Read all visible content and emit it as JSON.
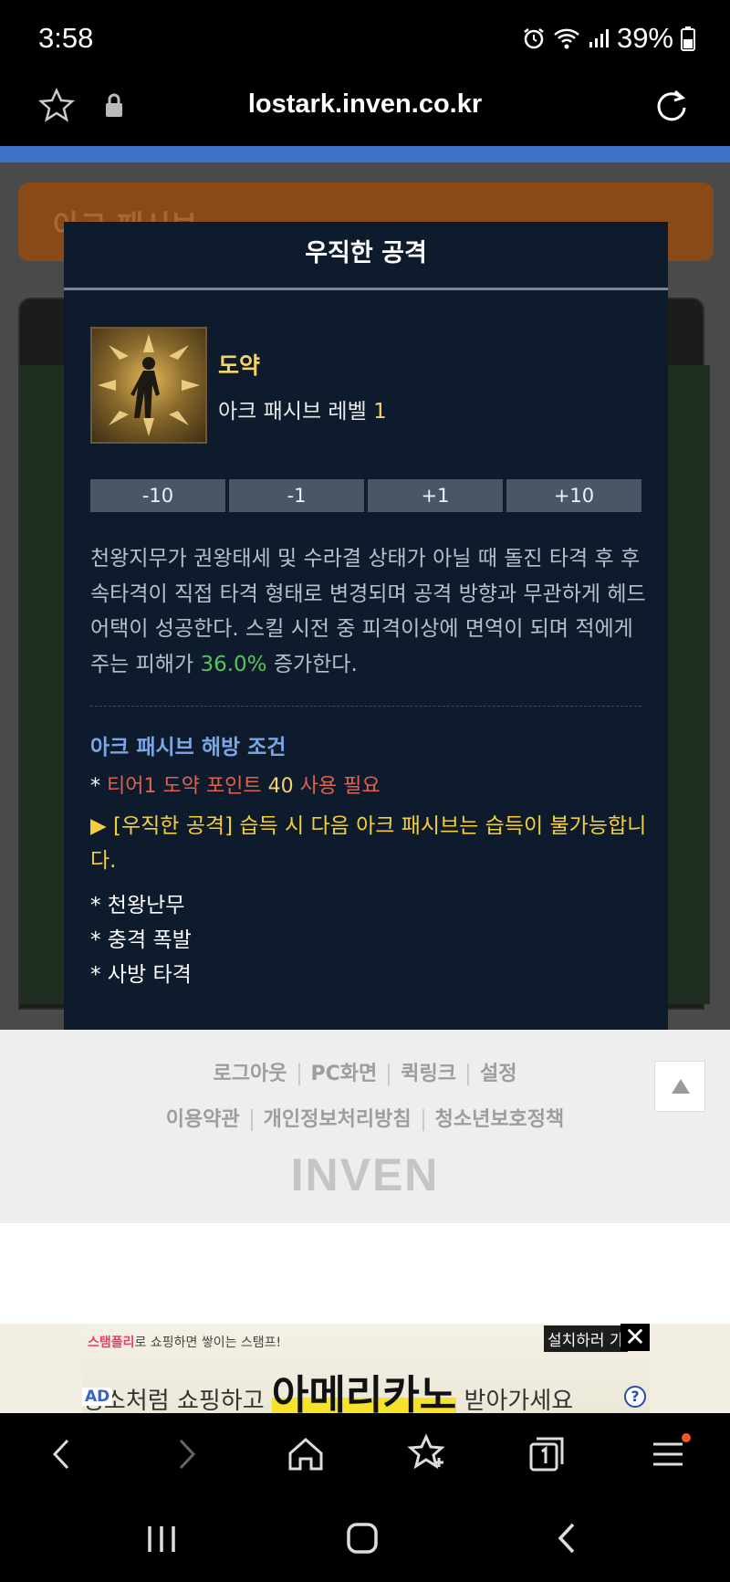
{
  "status_bar": {
    "time": "3:58",
    "battery": "39%"
  },
  "url_bar": {
    "url": "lostark.inven.co.kr"
  },
  "background": {
    "banner_text": "아크 패시브"
  },
  "modal": {
    "title": "우직한 공격",
    "skill_name": "도약",
    "level_label": "아크 패시브 레벨",
    "level_value": "1",
    "buttons": [
      "-10",
      "-1",
      "+1",
      "+10"
    ],
    "description_1": "천왕지무가 권왕태세 및 수라결 상태가 아닐 때 돌진 타격 후 후속타격이 직접 타격 형태로 변경되며 공격 방향과 무관하게 헤드어택이 성공한다. 스킬 시전 중 피격이상에 면역이 되며 적에게 주는 피해가 ",
    "description_highlight": "36.0%",
    "description_2": " 증가한다.",
    "condition_title": "아크 패시브 해방 조건",
    "condition_prefix": "* ",
    "condition_red": "티어1 도약 포인트 ",
    "condition_points": "40",
    "condition_suffix": " 사용 필요",
    "warning": "▶ [우직한 공격] 습득 시 다음 아크 패시브는 습득이 불가능합니다.",
    "excluded": [
      "* 천왕난무",
      "* 충격 폭발",
      "* 사방 타격"
    ]
  },
  "footer": {
    "row1": [
      "로그아웃",
      "PC화면",
      "퀵링크",
      "설정"
    ],
    "row2": [
      "이용약관",
      "개인정보처리방침",
      "청소년보호정책"
    ],
    "logo": "INVEN"
  },
  "ad": {
    "small_pink": "스탬플리",
    "small_text": "로 쇼핑하면 쌓이는 스탬프!",
    "main_pre": "평소처럼 쇼핑하고 ",
    "main_big": "아메리카노",
    "main_post": " 받아가세요",
    "install": "설치하러 가",
    "close": "✕",
    "tag": "AD",
    "help": "?"
  }
}
